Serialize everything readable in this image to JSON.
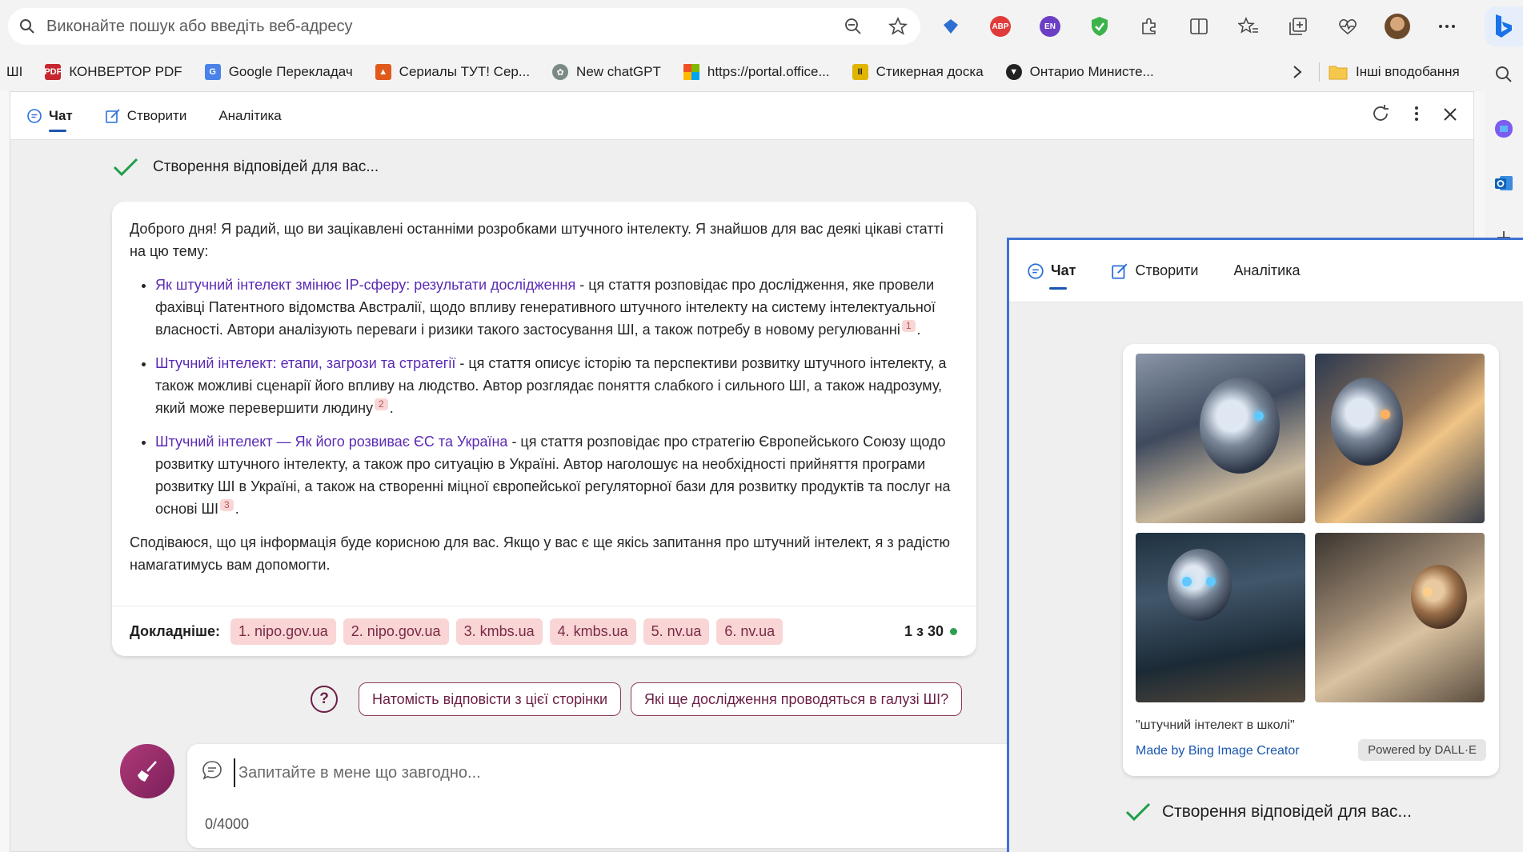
{
  "browser": {
    "address_placeholder": "Виконайте пошук або введіть веб-адресу",
    "extensions": [
      {
        "name": "ABP",
        "color": "#e03b3b"
      },
      {
        "name": "EN",
        "color": "#6b3fc4"
      }
    ]
  },
  "bookmarks": {
    "first": "ШІ",
    "items": [
      {
        "label": "КОНВЕРТОР PDF",
        "icon": "pdf24-icon",
        "color": "#c6262e"
      },
      {
        "label": "Google Перекладач",
        "icon": "google-translate-icon",
        "color": "#4a82e8"
      },
      {
        "label": "Сериалы ТУТ! Сер...",
        "icon": "serials-icon",
        "color": "#e05a1c"
      },
      {
        "label": "New chatGPT",
        "icon": "chatgpt-icon",
        "color": "#7a8a86"
      },
      {
        "label": "https://portal.office...",
        "icon": "microsoft-icon",
        "color": "#f25022"
      },
      {
        "label": "Стикерная доска",
        "icon": "sticker-board-icon",
        "color": "#e0b400"
      },
      {
        "label": "Онтарио Министе...",
        "icon": "ontario-icon",
        "color": "#222222"
      }
    ],
    "other_folder": "Інші вподобання"
  },
  "chat": {
    "tabs": [
      {
        "label": "Чат",
        "active": true
      },
      {
        "label": "Створити",
        "active": false
      },
      {
        "label": "Аналітика",
        "active": false
      }
    ],
    "status": "Створення відповідей для вас...",
    "answer": {
      "intro": "Доброго дня! Я радий, що ви зацікавлені останніми розробками штучного інтелекту. Я знайшов для вас деякі цікаві статті на цю тему:",
      "items": [
        {
          "link": "Як штучний інтелект змінює IP-сферу: результати дослідження",
          "text": " - ця стаття розповідає про дослідження, яке провели фахівці Патентного відомства Австралії, щодо впливу генеративного штучного інтелекту на систему інтелектуальної власності. Автори аналізують переваги і ризики такого застосування ШІ, а також потребу в новому регулюванні",
          "cite": "1"
        },
        {
          "link": "Штучний інтелект: етапи, загрози та стратегії",
          "text": " - ця стаття описує історію та перспективи розвитку штучного інтелекту, а також можливі сценарії його впливу на людство. Автор розглядає поняття слабкого і сильного ШІ, а також надрозуму, який може перевершити людину",
          "cite": "2"
        },
        {
          "link": "Штучний інтелект — Як його розвиває ЄС та Україна",
          "text": " - ця стаття розповідає про стратегію Європейського Союзу щодо розвитку штучного інтелекту, а також про ситуацію в Україні. Автор наголошує на необхідності прийняття програми розвитку ШІ в Україні, а також на створенні міцної європейської регуляторної бази для розвитку продуктів та послуг на основі ШІ",
          "cite": "3"
        }
      ],
      "outro": "Сподіваюся, що ця інформація буде корисною для вас. Якщо у вас є ще якісь запитання про штучний інтелект, я з радістю намагатимусь вам допомогти.",
      "more_label": "Докладніше:",
      "sources": [
        "1. nipo.gov.ua",
        "2. nipo.gov.ua",
        "3. kmbs.ua",
        "4. kmbs.ua",
        "5. nv.ua",
        "6. nv.ua"
      ],
      "count": "1 з 30"
    },
    "suggestions": [
      "Натомість відповісти з цієї сторінки",
      "Які ще дослідження проводяться в галузі ШІ?"
    ],
    "input_placeholder": "Запитайте в мене що завгодно...",
    "char_count": "0/4000"
  },
  "overlay": {
    "tabs": [
      {
        "label": "Чат",
        "active": true
      },
      {
        "label": "Створити",
        "active": false
      },
      {
        "label": "Аналітика",
        "active": false
      }
    ],
    "image_caption": "\"штучний інтелект в школі\"",
    "made_by": "Made by Bing Image Creator",
    "powered_by": "Powered by DALL·E",
    "status": "Створення відповідей для вас..."
  }
}
